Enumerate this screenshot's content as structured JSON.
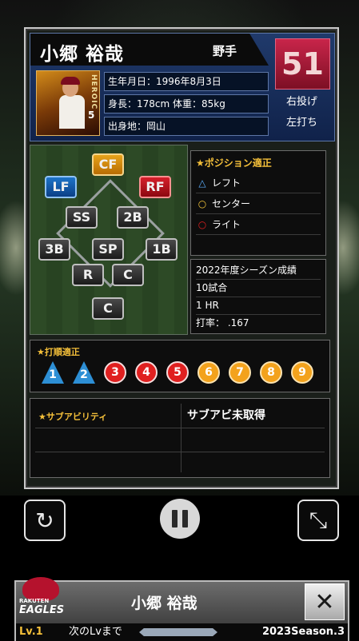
{
  "player": {
    "name": "小郷 裕哉",
    "position": "野手",
    "number": "51",
    "throws": "右投げ",
    "bats": "左打ち",
    "birthday": "生年月日：1996年8月3日",
    "body": "身長：178cm 体重：85kg",
    "hometown": "出身地：岡山",
    "card_jersey_number": "5",
    "card_badge_text": "HEROIC"
  },
  "field": {
    "positions": [
      {
        "label": "CF",
        "style": "cf"
      },
      {
        "label": "LF",
        "style": "lf"
      },
      {
        "label": "RF",
        "style": "rf"
      },
      {
        "label": "SS",
        "style": ""
      },
      {
        "label": "2B",
        "style": ""
      },
      {
        "label": "3B",
        "style": ""
      },
      {
        "label": "SP",
        "style": ""
      },
      {
        "label": "1B",
        "style": ""
      },
      {
        "label": "R",
        "style": ""
      },
      {
        "label": "C",
        "style": ""
      },
      {
        "label": "C",
        "style": ""
      }
    ]
  },
  "aptitude": {
    "title": "★ポジション適正",
    "rows": [
      {
        "mark": "△",
        "mark_color": "#5db0ff",
        "label": "レフト"
      },
      {
        "mark": "○",
        "mark_color": "#f3c43a",
        "label": "センター"
      },
      {
        "mark": "○",
        "mark_color": "#e02020",
        "label": "ライト"
      }
    ]
  },
  "season": {
    "title": "2022年度シーズン成績",
    "games": "10試合",
    "hr": "1 HR",
    "avg": "打率： .167"
  },
  "batting_order": {
    "title": "★打順適正",
    "items": [
      {
        "n": "1",
        "kind": "tri"
      },
      {
        "n": "2",
        "kind": "tri"
      },
      {
        "n": "3",
        "kind": "red"
      },
      {
        "n": "4",
        "kind": "red"
      },
      {
        "n": "5",
        "kind": "red"
      },
      {
        "n": "6",
        "kind": "gold"
      },
      {
        "n": "7",
        "kind": "gold"
      },
      {
        "n": "8",
        "kind": "gold"
      },
      {
        "n": "9",
        "kind": "gold"
      }
    ]
  },
  "sub_ability": {
    "title": "★サブアビリティ",
    "none_text": "サブアビ未取得"
  },
  "controls": {
    "refresh_icon": "↻",
    "fullscreen_icon": "⤡"
  },
  "bottom": {
    "name": "小郷 裕哉",
    "team_small": "RAKUTEN",
    "team_big": "EAGLES",
    "close": "✕",
    "lv": "Lv.1",
    "next": "次のLvまで",
    "season": "2023Season.3"
  },
  "colors": {
    "accent_gold": "#f5c03a",
    "number_red": "#c8254a",
    "header_blue": "#203a6b"
  }
}
